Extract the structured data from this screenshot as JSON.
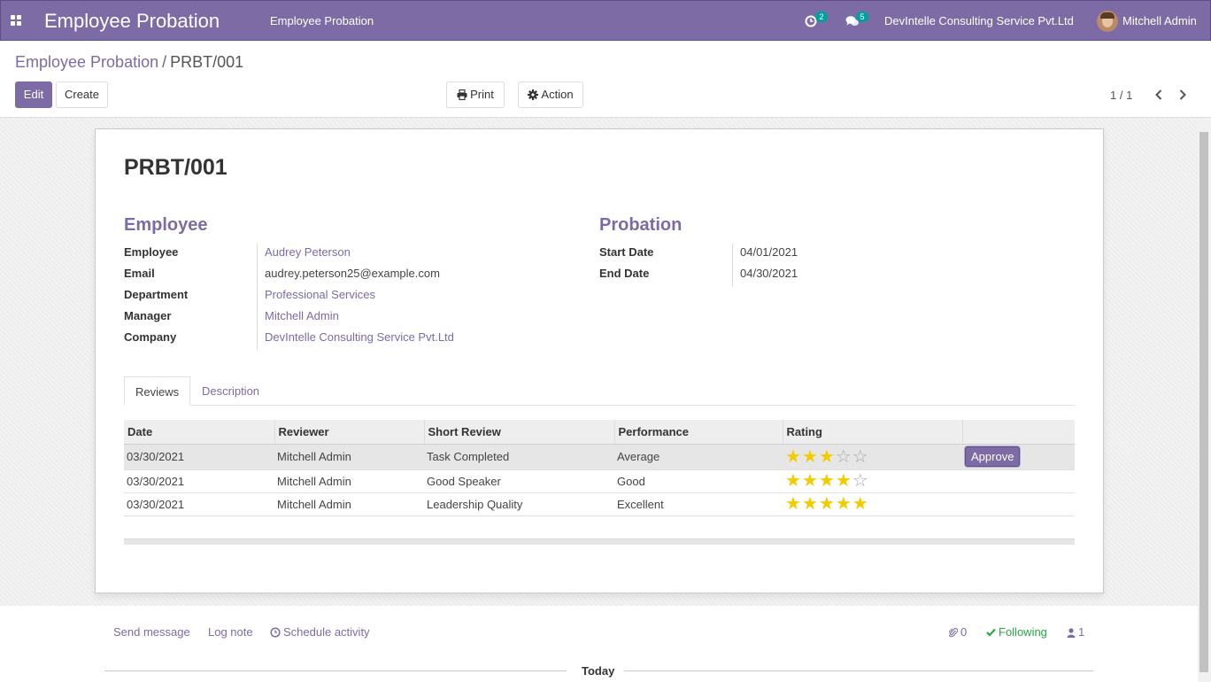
{
  "navbar": {
    "app_title": "Employee Probation",
    "menu_item": "Employee Probation",
    "activity_count": "2",
    "messages_count": "5",
    "company": "DevIntelle Consulting Service Pvt.Ltd",
    "user": "Mitchell Admin"
  },
  "breadcrumb": {
    "parent": "Employee Probation",
    "separator": "/",
    "current": "PRBT/001"
  },
  "controls": {
    "edit": "Edit",
    "create": "Create",
    "print": "Print",
    "action": "Action",
    "pager": "1 / 1"
  },
  "record": {
    "name": "PRBT/001",
    "employee_group": {
      "title": "Employee",
      "employee_label": "Employee",
      "employee": "Audrey Peterson",
      "email_label": "Email",
      "email": "audrey.peterson25@example.com",
      "department_label": "Department",
      "department": "Professional Services",
      "manager_label": "Manager",
      "manager": "Mitchell Admin",
      "company_label": "Company",
      "company": "DevIntelle Consulting Service Pvt.Ltd"
    },
    "probation_group": {
      "title": "Probation",
      "start_label": "Start Date",
      "start": "04/01/2021",
      "end_label": "End Date",
      "end": "04/30/2021"
    }
  },
  "tabs": [
    "Reviews",
    "Description"
  ],
  "reviews": {
    "columns": [
      "Date",
      "Reviewer",
      "Short Review",
      "Performance",
      "Rating",
      ""
    ],
    "rows": [
      {
        "date": "03/30/2021",
        "reviewer": "Mitchell Admin",
        "short_review": "Task Completed",
        "performance": "Average",
        "rating": 3,
        "action": "Approve"
      },
      {
        "date": "03/30/2021",
        "reviewer": "Mitchell Admin",
        "short_review": "Good Speaker",
        "performance": "Good",
        "rating": 4,
        "action": ""
      },
      {
        "date": "03/30/2021",
        "reviewer": "Mitchell Admin",
        "short_review": "Leadership Quality",
        "performance": "Excellent",
        "rating": 5,
        "action": ""
      }
    ],
    "max_rating": 5
  },
  "chatter": {
    "send_message": "Send message",
    "log_note": "Log note",
    "schedule_activity": "Schedule activity",
    "attachments": "0",
    "following": "Following",
    "followers": "1",
    "today": "Today"
  },
  "colors": {
    "brand": "#7c6ba5",
    "badge": "#00a09d",
    "star": "#f3cc00",
    "following": "#28a745"
  }
}
